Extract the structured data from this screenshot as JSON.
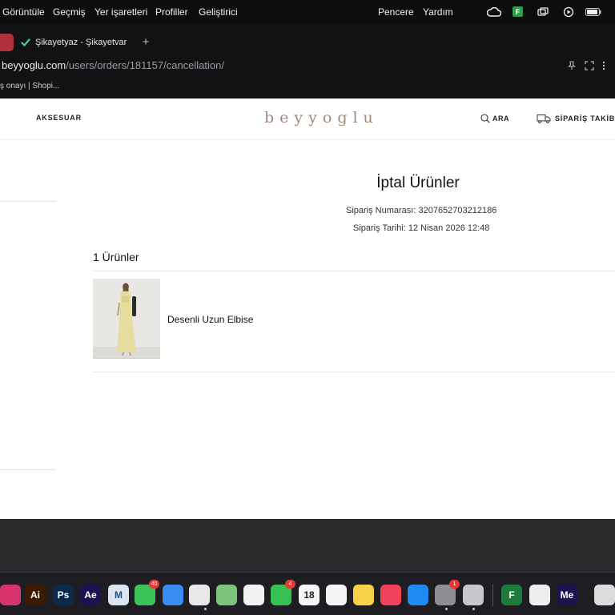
{
  "menubar": {
    "items": [
      "Görüntüle",
      "Geçmiş",
      "Yer işaretleri",
      "Profiller",
      "Geliştirici"
    ],
    "right_items": [
      "Pencere",
      "Yardım"
    ],
    "status_icons": [
      "creative-cloud-icon",
      "f-app-icon",
      "screens-icon",
      "play-icon",
      "battery-icon"
    ],
    "status_f_label": "F"
  },
  "browser": {
    "tab_title": "Şikayetyaz - Şikayetvar",
    "new_tab_glyph": "+",
    "url_host": "beyyoglu.com",
    "url_path": "/users/orders/181157/cancellation/",
    "bookmarks_text": "ş onayı | Shopi..."
  },
  "site": {
    "nav_accessory": "AKSESUAR",
    "logo": "beyyoglu",
    "search_label": "ARA",
    "tracking_label": "SİPARİŞ TAKİBİ"
  },
  "order": {
    "title": "İptal Ürünler",
    "number_line": "Sipariş Numarası: 3207652703212186",
    "date_line": "Sipariş Tarihi: 12 Nisan 2026 12:48",
    "count_label": "1 Ürünler",
    "products": [
      {
        "name": "Desenli Uzun Elbise"
      }
    ]
  },
  "dock": {
    "apps": [
      {
        "name": "creative-cloud",
        "label": "",
        "color": "#d6336c"
      },
      {
        "name": "illustrator",
        "label": "Ai",
        "color": "#3b1a00"
      },
      {
        "name": "photoshop",
        "label": "Ps",
        "color": "#0b2a4a"
      },
      {
        "name": "after-effects",
        "label": "Ae",
        "color": "#1b1450"
      },
      {
        "name": "m-app",
        "label": "M",
        "color": "#d9e6f2"
      },
      {
        "name": "messages",
        "label": "",
        "color": "#3cc45a",
        "badge": "40"
      },
      {
        "name": "mail",
        "label": "",
        "color": "#3a8cf0"
      },
      {
        "name": "pdf",
        "label": "",
        "color": "#e8e8e8"
      },
      {
        "name": "maps",
        "label": "",
        "color": "#7cc47c"
      },
      {
        "name": "photos",
        "label": "",
        "color": "#f2f2f2"
      },
      {
        "name": "facetime",
        "label": "",
        "color": "#35c153",
        "badge": "4"
      },
      {
        "name": "calendar",
        "label": "18",
        "color": "#f6f6f6"
      },
      {
        "name": "reminders",
        "label": "",
        "color": "#f5f5f5"
      },
      {
        "name": "notes",
        "label": "",
        "color": "#f7d24a"
      },
      {
        "name": "music",
        "label": "",
        "color": "#f2425a"
      },
      {
        "name": "app-store",
        "label": "",
        "color": "#1f8af0"
      },
      {
        "name": "system-settings",
        "label": "",
        "color": "#8e8e93",
        "badge": "1"
      },
      {
        "name": "iphone-mirroring",
        "label": "",
        "color": "#c7c7cc"
      },
      {
        "name": "f-app",
        "label": "F",
        "color": "#1d7a3a"
      },
      {
        "name": "textedit",
        "label": "",
        "color": "#eeeeee"
      },
      {
        "name": "media-encoder",
        "label": "Me",
        "color": "#1b1450"
      },
      {
        "name": "preview",
        "label": "",
        "color": "#dcdcdc"
      }
    ]
  }
}
